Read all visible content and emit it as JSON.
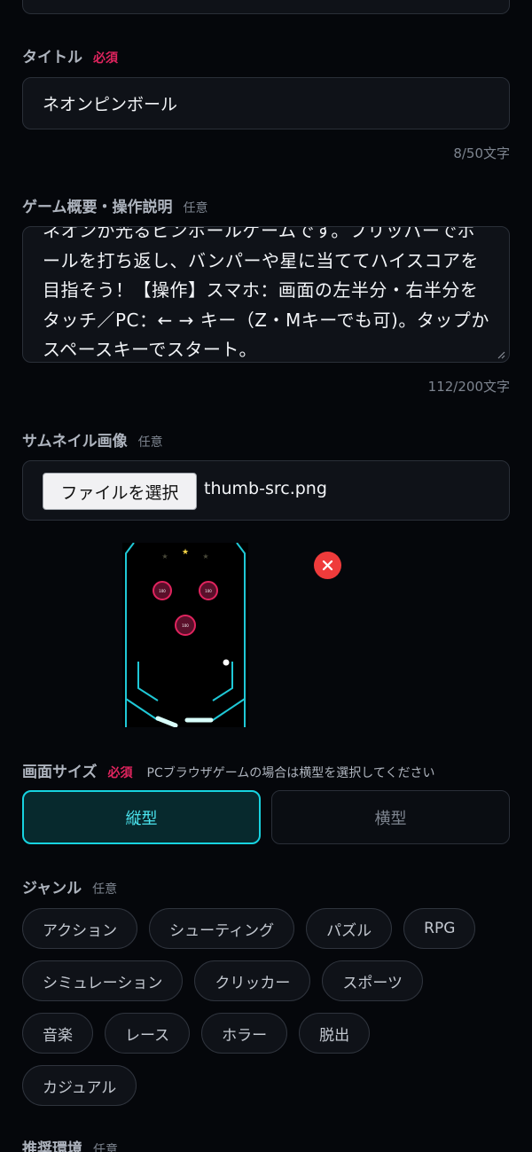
{
  "title_field": {
    "label": "タイトル",
    "required": "必須",
    "value": "ネオンピンボール",
    "counter": "8/50文字"
  },
  "description_field": {
    "label": "ゲーム概要・操作説明",
    "optional": "任意",
    "text": "ネオンが光るピンボールゲームです。フリッパーでボールを打ち返し、バンパーや星に当ててハイスコアを目指そう！【操作】スマホ：画面の左半分・右半分をタッチ／PC：← → キー（Z・Mキーでも可)。タップかスペースキーでスタート。",
    "counter": "112/200文字"
  },
  "thumbnail_field": {
    "label": "サムネイル画像",
    "optional": "任意",
    "file_button": "ファイルを選択",
    "file_name": "thumb-src.png",
    "preview": {
      "bumper_labels": [
        "100",
        "100",
        "100"
      ],
      "colors": {
        "wall": "#1fc8d6",
        "bumper": "#e0245e",
        "star": "#f5d547",
        "flipper": "#d9fffb"
      }
    }
  },
  "screen_size_field": {
    "label": "画面サイズ",
    "required": "必須",
    "hint": "PCブラウザゲームの場合は横型を選択してください",
    "options": [
      "縦型",
      "横型"
    ],
    "selected": "縦型"
  },
  "genre_field": {
    "label": "ジャンル",
    "optional": "任意",
    "chips": [
      "アクション",
      "シューティング",
      "パズル",
      "RPG",
      "シミュレーション",
      "クリッカー",
      "スポーツ",
      "音楽",
      "レース",
      "ホラー",
      "脱出",
      "カジュアル"
    ]
  },
  "environment_field": {
    "label": "推奨環境",
    "optional": "任意"
  },
  "colors": {
    "background": "#05070b",
    "required": "#e0245e",
    "accent": "#17d3e0",
    "danger": "#ef3b3b"
  }
}
